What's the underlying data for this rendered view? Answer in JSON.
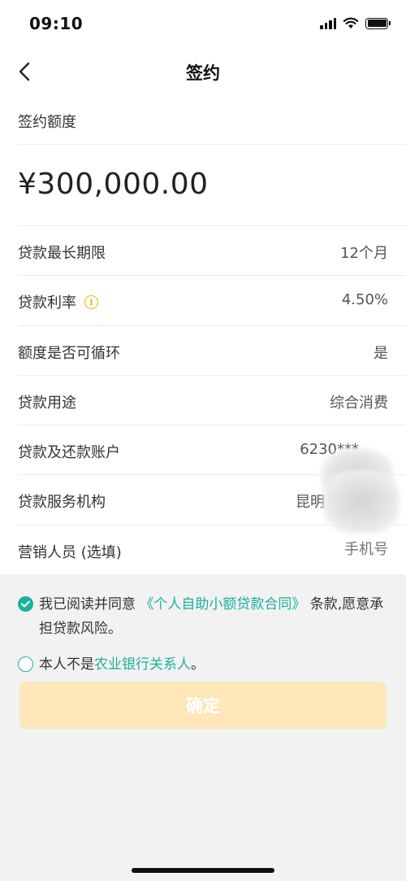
{
  "status_bar": {
    "time": "09:10"
  },
  "nav": {
    "title": "签约"
  },
  "quota": {
    "label": "签约额度",
    "amount": "¥300,000.00"
  },
  "rows": [
    {
      "label": "贷款最长期限",
      "value": "12个月"
    },
    {
      "label": "贷款利率",
      "value": "4.50%"
    },
    {
      "label": "额度是否可循环",
      "value": "是"
    },
    {
      "label": "贷款用途",
      "value": "综合消费"
    },
    {
      "label": "贷款及还款账户",
      "value": "6230***"
    },
    {
      "label": "贷款服务机构",
      "value": "昆明"
    },
    {
      "label": "营销人员 (选填)",
      "placeholder": "手机号"
    }
  ],
  "agreement": {
    "line1_prefix": "我已阅读并同意",
    "contract_link": "《个人自助小额贷款合同》",
    "line1_suffix": " 条款,愿意承担贷款风险。",
    "line2_prefix": "本人不是",
    "relation_link": "农业银行关系人",
    "line2_suffix": "。"
  },
  "confirm_label": "确定",
  "colors": {
    "accent": "#1ab09c",
    "button_disabled": "#fde7b8",
    "info": "#f0b400"
  }
}
